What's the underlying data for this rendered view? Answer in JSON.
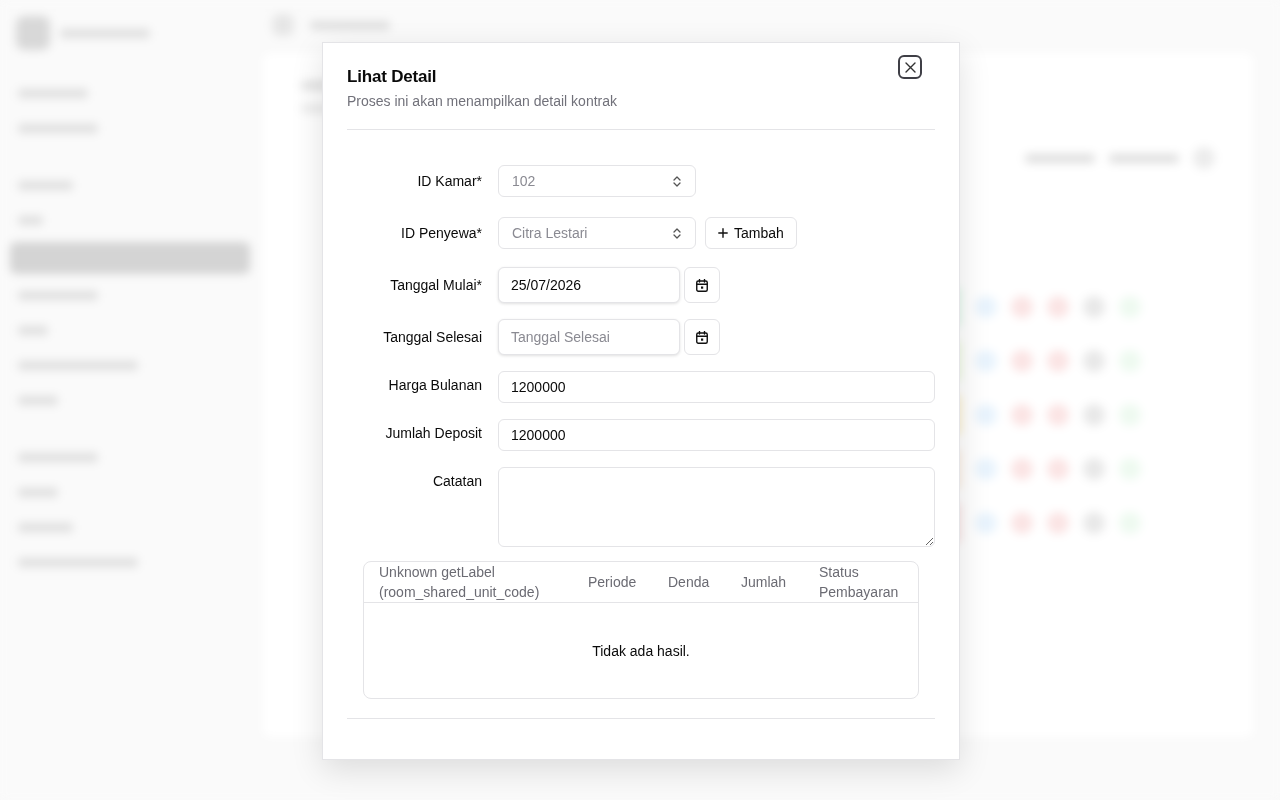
{
  "dialog": {
    "title": "Lihat Detail",
    "subtitle": "Proses ini akan menampilkan detail kontrak"
  },
  "form": {
    "fields": [
      {
        "kind": "select",
        "label": "ID Kamar*",
        "value": "102",
        "disabled": true
      },
      {
        "kind": "select",
        "label": "ID Penyewa*",
        "value": "Citra Lestari",
        "disabled": true,
        "button": "Tambah"
      },
      {
        "kind": "date",
        "label": "Tanggal Mulai*",
        "value": "25/07/2026",
        "disabled": false
      },
      {
        "kind": "date",
        "label": "Tanggal Selesai",
        "placeholder": "Tanggal Selesai",
        "disabled": false
      },
      {
        "kind": "text",
        "label": "Harga Bulanan",
        "value": "1200000",
        "disabled": false
      },
      {
        "kind": "text",
        "label": "Jumlah Deposit",
        "value": "1200000",
        "disabled": false
      },
      {
        "kind": "textarea",
        "label": "Catatan",
        "disabled": false
      }
    ]
  },
  "table": {
    "columns": [
      "Unknown getLabel (room_shared_unit_code)",
      "Periode",
      "Denda",
      "Jumlah",
      "Status Pembayaran"
    ],
    "empty_message": "Tidak ada hasil."
  }
}
